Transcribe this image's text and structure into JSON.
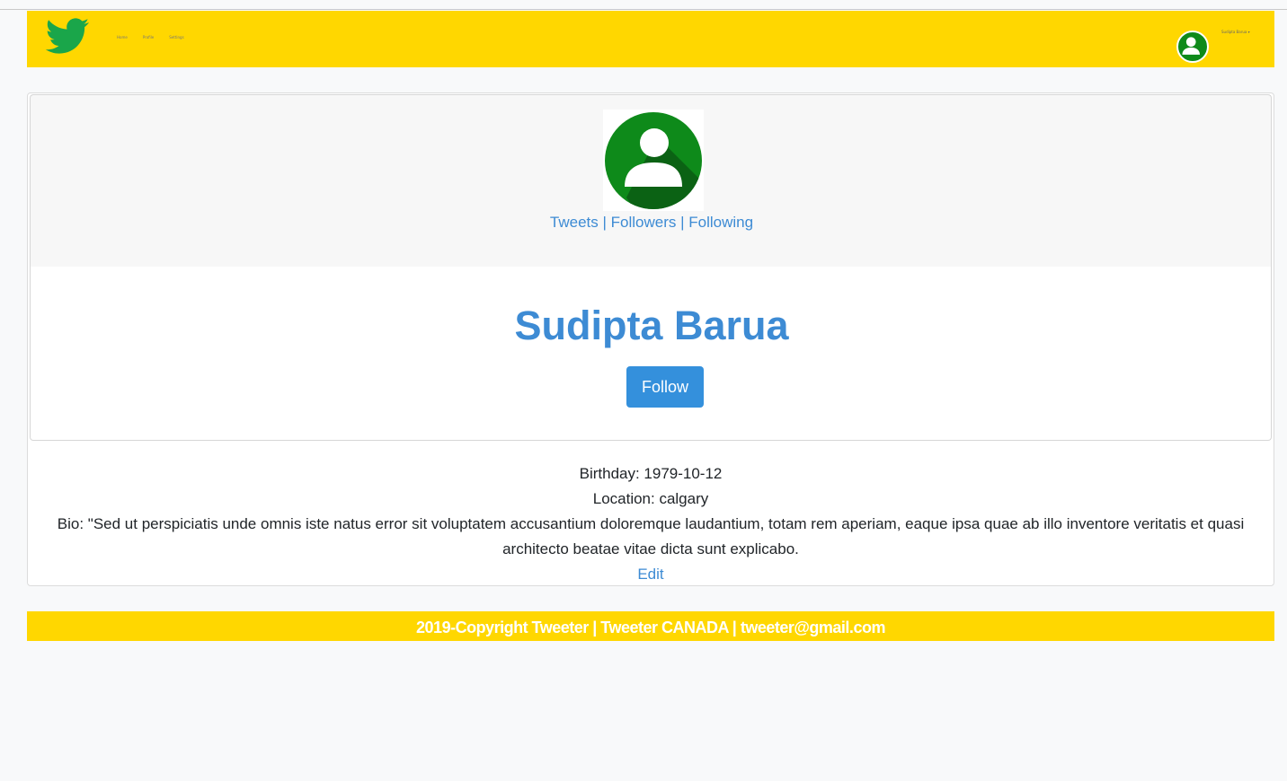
{
  "navbar": {
    "brand_icon": "twitter-bird-icon",
    "links": [
      "Home",
      "Profile",
      "Settings"
    ],
    "user_name": "Sudipta Barua ▾",
    "avatar_icon": "user-avatar-icon"
  },
  "profile": {
    "picture_icon": "user-avatar-icon",
    "stats": {
      "tweets": "Tweets",
      "sep1": " | ",
      "followers": "Followers",
      "sep2": " | ",
      "following": "Following"
    },
    "name": "Sudipta Barua",
    "follow_label": "Follow",
    "birthday": "Birthday: 1979-10-12",
    "location": "Location: calgary",
    "bio": "Bio: \"Sed ut perspiciatis unde omnis iste natus error sit voluptatem accusantium doloremque laudantium, totam rem aperiam, eaque ipsa quae ab illo inventore veritatis et quasi architecto beatae vitae dicta sunt explicabo.",
    "edit_label": "Edit"
  },
  "footer": {
    "text": "2019-Copyright Tweeter | Tweeter CANADA | tweeter@gmail.com"
  },
  "colors": {
    "brand_yellow": "#ffd700",
    "link_blue": "#3d8bd4",
    "button_blue": "#3490dc",
    "avatar_green": "#0e8a1a"
  }
}
